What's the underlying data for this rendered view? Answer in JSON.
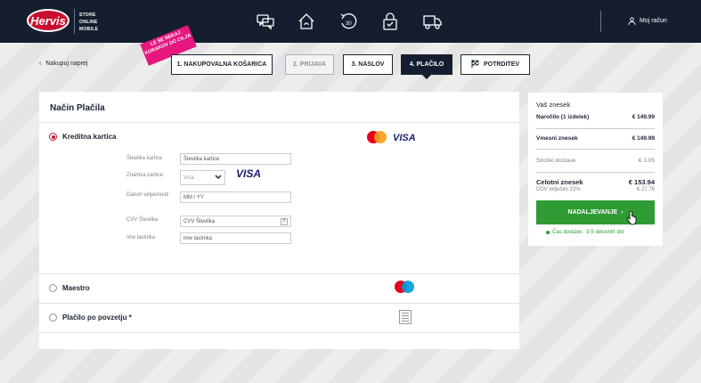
{
  "header": {
    "logo_text": "Hervis",
    "logo_tag_lines": [
      "STORE",
      "ONLINE",
      "MOBILE"
    ],
    "nav_icons": [
      "chat-icon",
      "home-return-icon",
      "return-30-icon",
      "lock-check-icon",
      "truck-icon"
    ],
    "account_label": "Moj račun"
  },
  "checkout": {
    "back_label": "Nakupuj naprej",
    "badge_text": "LE ŠE NEKAJ KORAKOV DO CILJA",
    "steps": [
      {
        "label": "1. NAKUPOVALNA KOŠARICA",
        "state": "done"
      },
      {
        "label": "2. PRIJAVA",
        "state": "disabled"
      },
      {
        "label": "3. NASLOV",
        "state": "done"
      },
      {
        "label": "4. PLAČILO",
        "state": "active"
      },
      {
        "label": "POTRDITEV",
        "state": "pending"
      }
    ]
  },
  "payment": {
    "title": "Način Plačila",
    "methods": [
      {
        "label": "Kreditna kartica",
        "selected": true
      },
      {
        "label": "Maestro",
        "selected": false
      },
      {
        "label": "Plačilo po povzetju *",
        "selected": false
      }
    ],
    "visa_text": "VISA",
    "form": {
      "card_number_label": "Številka kartice",
      "card_number_placeholder": "Številka kartice",
      "card_brand_label": "Znamka kartice",
      "card_brand_value": "Visa",
      "expiry_label": "Datum veljavnosti",
      "expiry_placeholder": "MM / YY",
      "cvv_label": "CVV Številka",
      "cvv_placeholder": "CVV Številka",
      "cvv_help": "?",
      "holder_label": "Ime lastnika",
      "holder_placeholder": "Ime lastnika"
    }
  },
  "summary": {
    "title": "Vaš znesek",
    "order_label": "Naročilo (1 izdelek)",
    "order_value": "€ 149.99",
    "subtotal_label": "Vmesni znesek",
    "subtotal_value": "€ 149.99",
    "shipping_label": "Stroški dostave",
    "shipping_value": "€ 3.05",
    "total_label": "Celotni znesek",
    "total_value": "€ 153.94",
    "vat_label": "DDV vključen 22%",
    "vat_value": "€ 27.76",
    "continue_label": "NADALJEVANJE",
    "delivery_label": "Čas dostave:",
    "delivery_days": "3-5 delovnih dni"
  },
  "colors": {
    "header_bg": "#141e2e",
    "brand_red": "#c8102e",
    "badge_pink": "#e6177e",
    "cta_green": "#2e9b35"
  }
}
